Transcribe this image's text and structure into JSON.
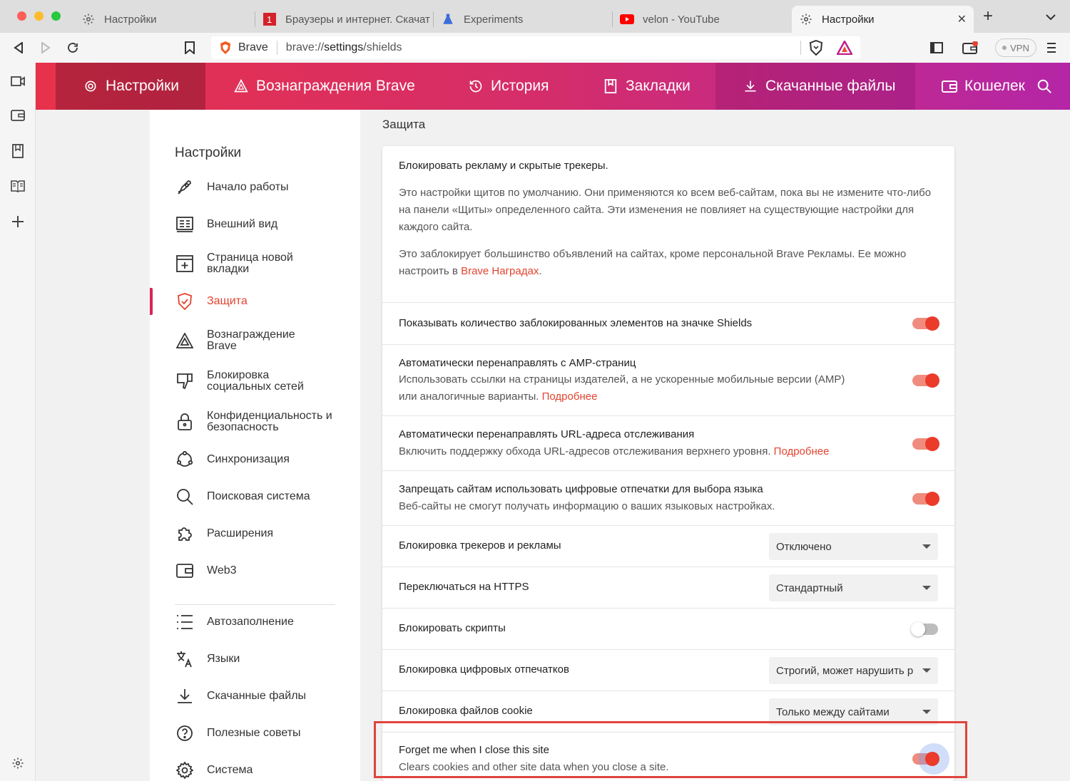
{
  "tabs": [
    {
      "title": "Настройки",
      "icon": "gear-icon"
    },
    {
      "title": "Браузеры и интернет. Скачат",
      "icon": "site-favicon-icon"
    },
    {
      "title": "Experiments",
      "icon": "flask-icon"
    },
    {
      "title": "velon - YouTube",
      "icon": "youtube-icon"
    },
    {
      "title": "Настройки",
      "icon": "gear-icon"
    }
  ],
  "toolbar": {
    "site_label": "Brave",
    "url_prefix": "brave://",
    "url_bold": "settings",
    "url_suffix": "/shields",
    "vpn_label": "VPN"
  },
  "header": {
    "items": [
      {
        "label": "Настройки",
        "icon": "gear-icon"
      },
      {
        "label": "Вознаграждения Brave",
        "icon": "triangle-icon"
      },
      {
        "label": "История",
        "icon": "history-icon"
      },
      {
        "label": "Закладки",
        "icon": "bookmark-icon"
      },
      {
        "label": "Скачанные файлы",
        "icon": "download-icon"
      },
      {
        "label": "Кошелек",
        "icon": "wallet-icon"
      }
    ]
  },
  "nav": {
    "title": "Настройки",
    "items": [
      {
        "label": "Начало работы",
        "icon": "rocket-icon"
      },
      {
        "label": "Внешний вид",
        "icon": "appearance-icon"
      },
      {
        "label": "Страница новой вкладки",
        "icon": "new-tab-icon"
      },
      {
        "label": "Защита",
        "icon": "shield-icon"
      },
      {
        "label": "Вознаграждение Brave",
        "icon": "triangle-icon"
      },
      {
        "label": "Блокировка социальных сетей",
        "icon": "thumbs-down-icon"
      },
      {
        "label": "Конфиденциальность и безопасность",
        "icon": "lock-icon"
      },
      {
        "label": "Синхронизация",
        "icon": "sync-icon"
      },
      {
        "label": "Поисковая система",
        "icon": "search-icon"
      },
      {
        "label": "Расширения",
        "icon": "puzzle-icon"
      },
      {
        "label": "Web3",
        "icon": "wallet-icon"
      },
      {
        "label": "Автозаполнение",
        "icon": "list-icon"
      },
      {
        "label": "Языки",
        "icon": "translate-icon"
      },
      {
        "label": "Скачанные файлы",
        "icon": "download-icon"
      },
      {
        "label": "Полезные советы",
        "icon": "help-icon"
      },
      {
        "label": "Система",
        "icon": "gear-icon"
      }
    ]
  },
  "section": {
    "title": "Защита",
    "intro_title": "Блокировать рекламу и скрытые трекеры.",
    "intro_p1": "Это настройки щитов по умолчанию. Они применяются ко всем веб-сайтам, пока вы не измените что-либо на панели «Щиты» определенного сайта. Эти изменения не повлияет на существующие настройки для каждого сайта.",
    "intro_p2_text": "Это заблокирует большинство объявлений на сайтах, кроме персональной Brave Рекламы. Ее можно настроить в ",
    "intro_p2_link": "Brave Наградах",
    "intro_p2_end": "."
  },
  "settings": {
    "show_count": {
      "title": "Показывать количество заблокированных элементов на значке Shields",
      "state": "on"
    },
    "amp": {
      "title": "Автоматически перенаправлять с AMP-страниц",
      "sub": "Использовать ссылки на страницы издателей, а не ускоренные мобильные версии (AMP)",
      "sub2": "или аналогичные варианты.",
      "link": "Подробнее",
      "state": "on"
    },
    "tracking_url": {
      "title": "Автоматически перенаправлять URL-адреса отслеживания",
      "sub": "Включить поддержку обхода URL-адресов отслеживания верхнего уровня.",
      "link": "Подробнее",
      "state": "on"
    },
    "fingerprint_lang": {
      "title": "Запрещать сайтам использовать цифровые отпечатки для выбора языка",
      "sub": "Веб-сайты не смогут получать информацию о ваших языковых настройках.",
      "state": "on"
    },
    "trackers_ads": {
      "title": "Блокировка трекеров и рекламы",
      "value": "Отключено"
    },
    "https": {
      "title": "Переключаться на HTTPS",
      "value": "Стандартный"
    },
    "scripts": {
      "title": "Блокировать скрипты",
      "state": "off"
    },
    "fingerprinting": {
      "title": "Блокировка цифровых отпечатков",
      "value": "Строгий, может нарушить р"
    },
    "cookies": {
      "title": "Блокировка файлов cookie",
      "value": "Только между сайтами"
    },
    "forget_me": {
      "title": "Forget me when I close this site",
      "sub": "Clears cookies and other site data when you close a site.",
      "state": "on"
    }
  },
  "colors": {
    "accent": "#e2442f",
    "toggle_on": "#ea3b2b",
    "highlight": "#e0443d"
  }
}
